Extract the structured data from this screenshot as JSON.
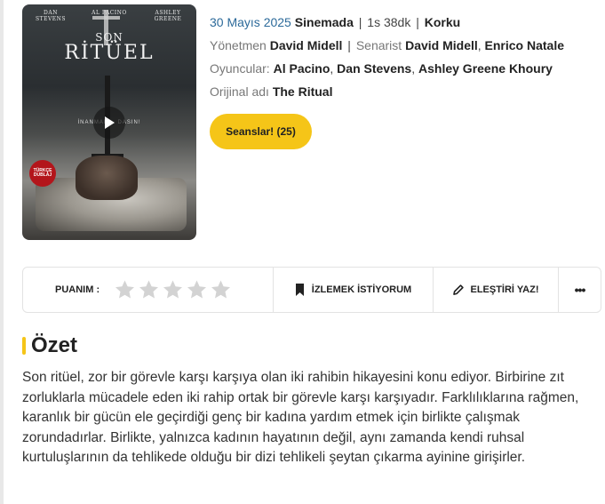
{
  "poster": {
    "names": [
      "DAN STEVENS",
      "AL PACINO",
      "ASHLEY GREENE"
    ],
    "title_line1": "SON",
    "title_line2": "RİTÜEL",
    "tagline": "İNANMAK... DASIN!",
    "badge_line1": "TÜRKÇE",
    "badge_line2": "DUBLAJ"
  },
  "movie": {
    "date": "30 Mayıs 2025",
    "status": "Sinemada",
    "duration": "1s 38dk",
    "genre": "Korku",
    "director_label": "Yönetmen",
    "director": "David Midell",
    "writer_label": "Senarist",
    "writers": [
      "David Midell",
      "Enrico Natale"
    ],
    "cast_label": "Oyuncular:",
    "cast": [
      "Al Pacino",
      "Dan Stevens",
      "Ashley Greene Khoury"
    ],
    "original_label": "Orijinal adı",
    "original_title": "The Ritual"
  },
  "sessions_button": "Seanslar! (25)",
  "actions": {
    "rating_label": "PUANIM :",
    "star_count": 5,
    "rating_value": 0,
    "watchlist_label": "İZLEMEK İSTİYORUM",
    "review_label": "ELEŞTİRİ YAZ!",
    "more_label": "•••"
  },
  "summary": {
    "heading": "Özet",
    "text": "Son ritüel, zor bir görevle karşı karşıya olan iki rahibin hikayesini konu ediyor. Birbirine zıt zorluklarla mücadele eden iki rahip ortak bir görevle karşı karşıyadır. Farklılıklarına rağmen, karanlık bir gücün ele geçirdiği genç bir kadına yardım etmek için birlikte çalışmak zorundadırlar. Birlikte, yalnızca kadının hayatının değil, aynı zamanda kendi ruhsal kurtuluşlarının da tehlikede olduğu bir dizi tehlikeli şeytan çıkarma ayinine girişirler."
  },
  "colors": {
    "accent": "#f5c518",
    "date": "#2c6a9a",
    "star_empty": "#d3d3d3"
  }
}
